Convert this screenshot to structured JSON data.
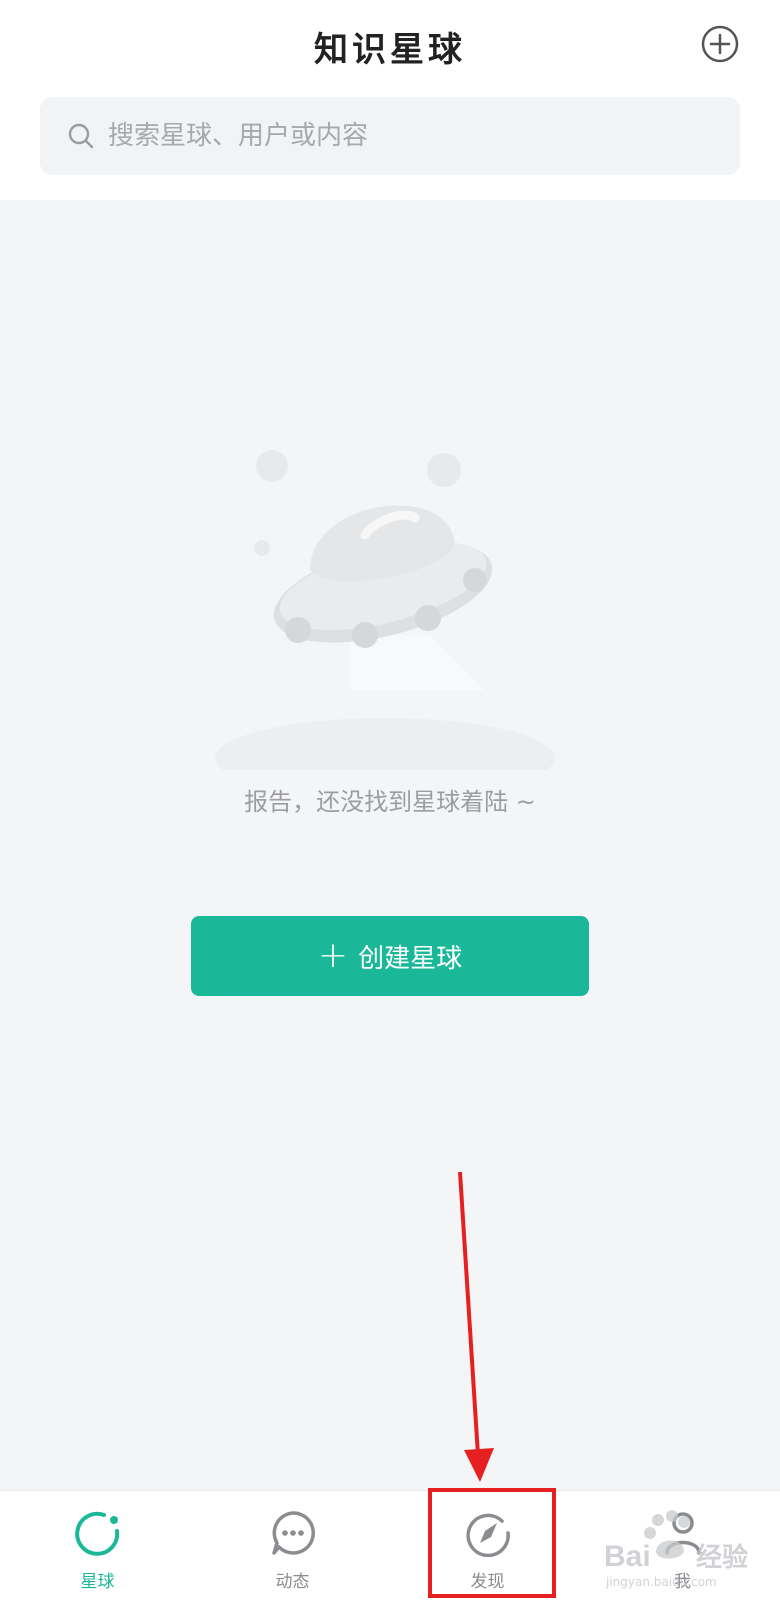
{
  "header": {
    "title": "知识星球",
    "add_icon": "plus-circle-icon"
  },
  "search": {
    "icon": "search-icon",
    "placeholder": "搜索星球、用户或内容"
  },
  "empty_state": {
    "illustration": "ufo-illustration",
    "message": "报告，还没找到星球着陆 ~",
    "button_label": "创建星球",
    "button_icon": "plus-icon",
    "accent_color": "#1ab899"
  },
  "tabbar": {
    "tabs": [
      {
        "label": "星球",
        "icon": "planet-ring-icon",
        "active": true
      },
      {
        "label": "动态",
        "icon": "chat-bubble-icon",
        "active": false
      },
      {
        "label": "发现",
        "icon": "compass-icon",
        "active": false
      },
      {
        "label": "我",
        "icon": "person-icon",
        "active": false
      }
    ]
  },
  "annotation": {
    "arrow_color": "#e62020",
    "highlighted_tab": "发现"
  },
  "watermark": {
    "brand": "Bai经验",
    "url": "jingyan.baidu.com"
  }
}
